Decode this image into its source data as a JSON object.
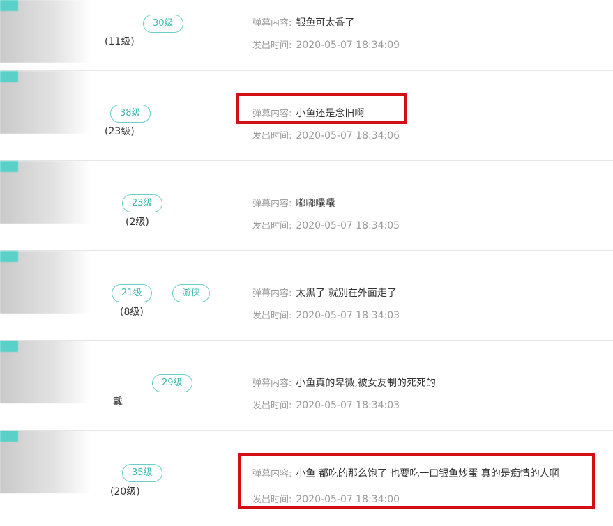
{
  "labels": {
    "content": "弹幕内容:",
    "time": "发出时间:"
  },
  "accent_color": "#3fb9b1",
  "highlight_color": "#d20f14",
  "items": [
    {
      "level_badge": "30级",
      "user_level": "(11级)",
      "content": "银鱼可太香了",
      "time": "2020-05-07 18:34:09"
    },
    {
      "level_badge": "38级",
      "user_level": "(23级)",
      "content": "小鱼还是念旧啊",
      "time": "2020-05-07 18:34:06"
    },
    {
      "level_badge": "23级",
      "user_level": "(2级)",
      "content": "嘟嘟囔囔",
      "time": "2020-05-07 18:34:05"
    },
    {
      "level_badge": "21级",
      "extra_badge": "游侠",
      "user_level": "(8级)",
      "content": "太黑了 就别在外面走了",
      "time": "2020-05-07 18:34:03"
    },
    {
      "level_badge": "29级",
      "user_level": "戴",
      "content": "小鱼真的卑微,被女友制的死死的",
      "time": "2020-05-07 18:34:03"
    },
    {
      "level_badge": "35级",
      "user_level": "(20级)",
      "content": "小鱼 都吃的那么饱了 也要吃一口银鱼炒蛋 真的是痴情的人啊",
      "time": "2020-05-07 18:34:00"
    }
  ]
}
